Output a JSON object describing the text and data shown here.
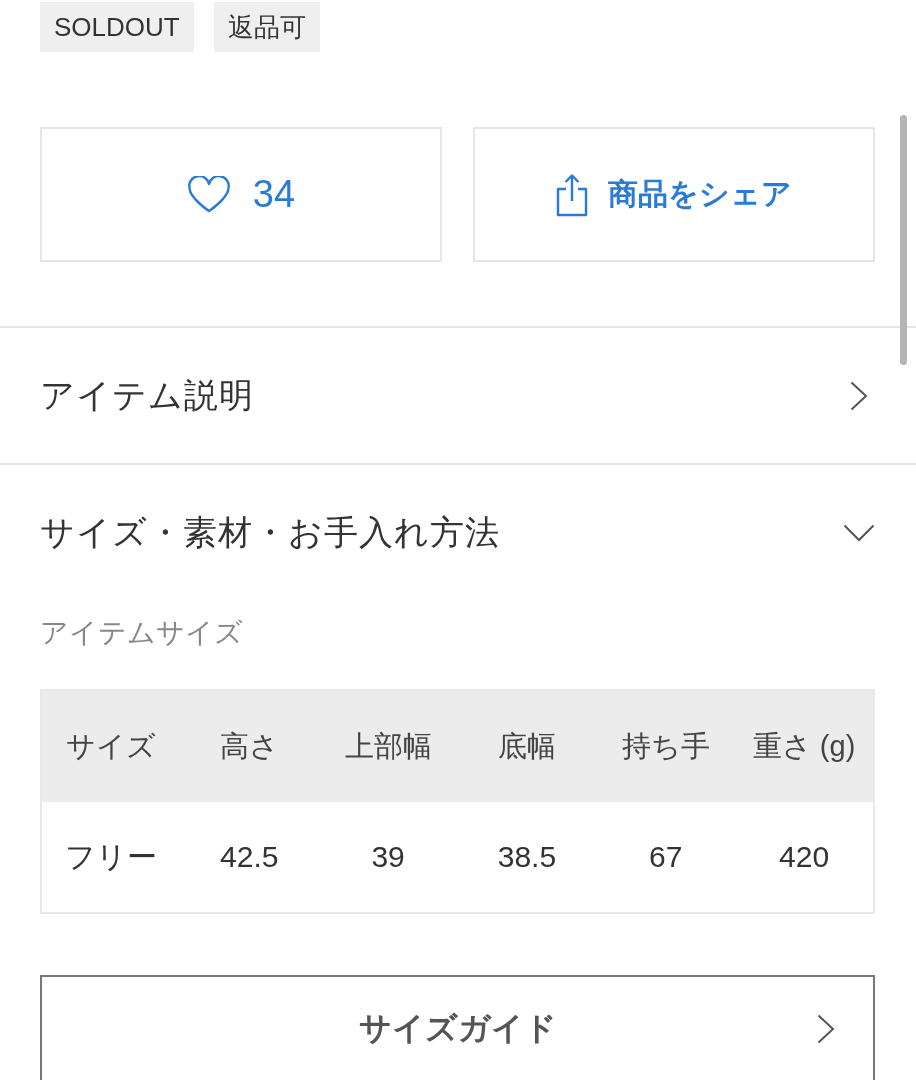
{
  "tags": [
    {
      "label": "SOLDOUT"
    },
    {
      "label": "返品可"
    }
  ],
  "actions": [
    {
      "kind": "like",
      "label": "34"
    },
    {
      "kind": "share",
      "label": "商品をシェア"
    }
  ],
  "sections": [
    {
      "title": "アイテム説明",
      "expanded": false
    },
    {
      "title": "サイズ・素材・お手入れ方法",
      "expanded": true,
      "subtitle": "アイテムサイズ",
      "table": {
        "columns": [
          "サイズ",
          "高さ",
          "上部幅",
          "底幅",
          "持ち手",
          "重さ (g)"
        ],
        "rows": [
          [
            "フリー",
            "42.5",
            "39",
            "38.5",
            "67",
            "420"
          ]
        ]
      },
      "guide_button": "サイズガイド"
    }
  ]
}
